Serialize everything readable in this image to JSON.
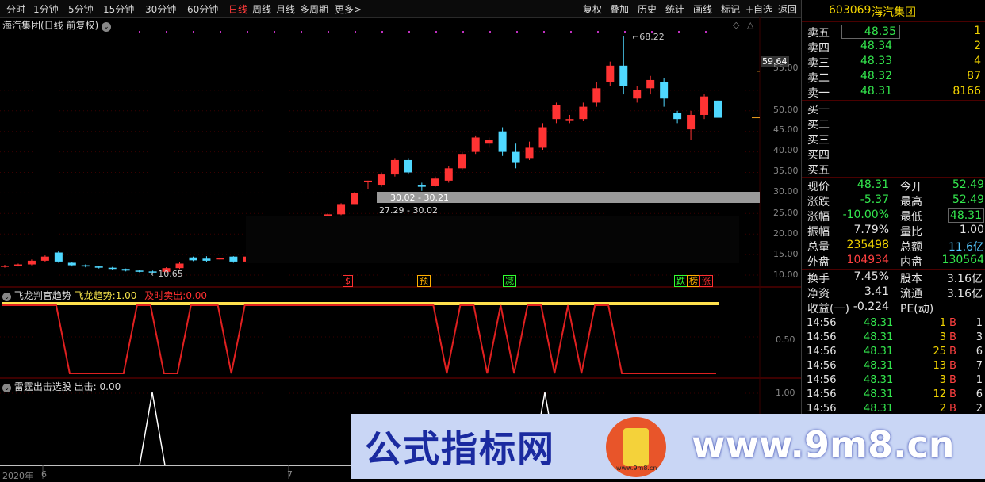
{
  "toolbar": {
    "left": [
      "分时",
      "1分钟",
      "5分钟",
      "15分钟",
      "30分钟",
      "60分钟",
      "日线",
      "周线",
      "月线",
      "多周期",
      "更多"
    ],
    "more_arrow": ">",
    "right": [
      "复权",
      "叠加",
      "历史",
      "统计",
      "画线",
      "标记",
      "+自选",
      "返回"
    ]
  },
  "main_pane": {
    "title": "海汽集团(日线 前复权)",
    "title_icon": "⌄",
    "high_label": "68.22",
    "low_label": "10.65",
    "price_tag": "59.64",
    "range_high": "30.02 - 30.21",
    "range_low": "27.29 - 30.02",
    "y_axis": [
      "55.00",
      "50.00",
      "45.00",
      "40.00",
      "35.00",
      "30.00",
      "25.00",
      "20.00",
      "15.00",
      "10.00"
    ],
    "signals": [
      {
        "text": "$",
        "color": "#ff3030"
      },
      {
        "text": "预",
        "color": "#ffb000"
      },
      {
        "text": "减",
        "color": "#30ff30"
      },
      {
        "text": "跌",
        "color": "#30ff30"
      },
      {
        "text": "榜",
        "color": "#ffb000"
      },
      {
        "text": "涨",
        "color": "#ff3030"
      }
    ],
    "candles": [
      {
        "o": 12.0,
        "c": 12.3,
        "h": 12.5,
        "l": 11.8
      },
      {
        "o": 12.3,
        "c": 12.6,
        "h": 12.8,
        "l": 12.1
      },
      {
        "o": 12.6,
        "c": 13.5,
        "h": 13.8,
        "l": 12.4
      },
      {
        "o": 13.5,
        "c": 14.5,
        "h": 14.8,
        "l": 13.3
      },
      {
        "o": 15.5,
        "c": 13.3,
        "h": 15.8,
        "l": 13.0
      },
      {
        "o": 13.0,
        "c": 12.4,
        "h": 13.2,
        "l": 12.1
      },
      {
        "o": 12.4,
        "c": 12.1,
        "h": 12.6,
        "l": 11.9
      },
      {
        "o": 12.1,
        "c": 11.8,
        "h": 12.3,
        "l": 11.6
      },
      {
        "o": 11.8,
        "c": 11.5,
        "h": 12.0,
        "l": 11.3
      },
      {
        "o": 11.5,
        "c": 11.1,
        "h": 11.6,
        "l": 10.9
      },
      {
        "o": 11.1,
        "c": 10.9,
        "h": 11.3,
        "l": 10.7
      },
      {
        "o": 10.9,
        "c": 10.8,
        "h": 11.1,
        "l": 10.65
      },
      {
        "o": 10.8,
        "c": 11.7,
        "h": 11.9,
        "l": 10.7
      },
      {
        "o": 11.7,
        "c": 12.8,
        "h": 13.2,
        "l": 11.5
      },
      {
        "o": 14.3,
        "c": 13.6,
        "h": 14.5,
        "l": 13.4
      },
      {
        "o": 14.0,
        "c": 13.5,
        "h": 14.6,
        "l": 13.2
      },
      {
        "o": 13.9,
        "c": 14.1,
        "h": 14.3,
        "l": 13.7
      },
      {
        "o": 14.5,
        "c": 13.3,
        "h": 14.6,
        "l": 13.0
      },
      {
        "o": 13.3,
        "c": 14.5,
        "h": 14.7,
        "l": 13.1
      },
      {
        "o": 14.5,
        "c": 15.5,
        "h": 15.8,
        "l": 14.3
      },
      {
        "o": 15.5,
        "c": 17.0,
        "h": 17.2,
        "l": 15.3
      },
      {
        "o": 17.0,
        "c": 18.6,
        "h": 18.8,
        "l": 16.8
      },
      {
        "o": 18.6,
        "c": 20.4,
        "h": 20.6,
        "l": 18.4
      },
      {
        "o": 20.4,
        "c": 22.5,
        "h": 22.7,
        "l": 20.2
      },
      {
        "o": 22.5,
        "c": 24.8,
        "h": 25.0,
        "l": 22.3
      },
      {
        "o": 24.8,
        "c": 27.29,
        "h": 27.5,
        "l": 24.6
      },
      {
        "o": 27.29,
        "c": 30.02,
        "h": 30.21,
        "l": 27.29
      },
      {
        "o": 33.0,
        "c": 33.0,
        "h": 33.0,
        "l": 31.0
      },
      {
        "o": 32.0,
        "c": 34.5,
        "h": 35.0,
        "l": 31.5
      },
      {
        "o": 34.5,
        "c": 38.0,
        "h": 38.5,
        "l": 34.0
      },
      {
        "o": 38.0,
        "c": 35.0,
        "h": 38.5,
        "l": 34.5
      },
      {
        "o": 32.0,
        "c": 31.5,
        "h": 32.5,
        "l": 30.5
      },
      {
        "o": 31.8,
        "c": 33.5,
        "h": 34.0,
        "l": 31.5
      },
      {
        "o": 33.0,
        "c": 36.0,
        "h": 36.5,
        "l": 32.5
      },
      {
        "o": 36.0,
        "c": 39.5,
        "h": 40.0,
        "l": 35.5
      },
      {
        "o": 40.0,
        "c": 43.5,
        "h": 44.0,
        "l": 39.5
      },
      {
        "o": 42.0,
        "c": 43.0,
        "h": 43.5,
        "l": 41.0
      },
      {
        "o": 45.0,
        "c": 40.0,
        "h": 46.0,
        "l": 39.0
      },
      {
        "o": 40.0,
        "c": 37.5,
        "h": 42.0,
        "l": 36.0
      },
      {
        "o": 38.5,
        "c": 41.0,
        "h": 42.5,
        "l": 38.0
      },
      {
        "o": 41.0,
        "c": 46.0,
        "h": 47.0,
        "l": 40.5
      },
      {
        "o": 48.0,
        "c": 51.5,
        "h": 52.0,
        "l": 47.0
      },
      {
        "o": 48.0,
        "c": 48.0,
        "h": 49.0,
        "l": 47.0
      },
      {
        "o": 48.0,
        "c": 51.0,
        "h": 52.0,
        "l": 47.5
      },
      {
        "o": 52.0,
        "c": 55.5,
        "h": 57.0,
        "l": 51.0
      },
      {
        "o": 57.0,
        "c": 61.0,
        "h": 62.0,
        "l": 56.0
      },
      {
        "o": 61.0,
        "c": 56.0,
        "h": 68.22,
        "l": 54.0
      },
      {
        "o": 53.0,
        "c": 55.0,
        "h": 56.0,
        "l": 52.0
      },
      {
        "o": 55.5,
        "c": 57.5,
        "h": 58.5,
        "l": 54.0
      },
      {
        "o": 57.0,
        "c": 53.0,
        "h": 58.0,
        "l": 51.0
      },
      {
        "o": 49.5,
        "c": 48.0,
        "h": 50.0,
        "l": 47.0
      },
      {
        "o": 45.5,
        "c": 49.0,
        "h": 50.0,
        "l": 43.0
      },
      {
        "o": 49.0,
        "c": 53.5,
        "h": 54.0,
        "l": 48.0
      },
      {
        "o": 52.5,
        "c": 48.31,
        "h": 52.5,
        "l": 48.31
      }
    ]
  },
  "feilong_pane": {
    "name": "飞龙判官趋势",
    "label1": "飞龙趋势:",
    "value1": "1.00",
    "label2": "及时卖出:",
    "value2": "0.00",
    "y_axis": [
      "0.50"
    ],
    "series": [
      1,
      1,
      1,
      1,
      1,
      0,
      0,
      0,
      0,
      0,
      1,
      1,
      0,
      0,
      1,
      1,
      1,
      0,
      1,
      1,
      1,
      1,
      1,
      1,
      1,
      1,
      1,
      1,
      1,
      1,
      1,
      1,
      1,
      0,
      1,
      1,
      0,
      1,
      0,
      1,
      1,
      0,
      1,
      0,
      1,
      1,
      0,
      0,
      0,
      0,
      0,
      0,
      0,
      0
    ]
  },
  "leiting_pane": {
    "name": "雷霆出击选股",
    "label": "出击:",
    "value": "0.00",
    "y_axis": [
      "1.00"
    ],
    "spikes": [
      12,
      44
    ],
    "date_year": "2020年",
    "date_marks": [
      "6",
      "7"
    ]
  },
  "quote_panel": {
    "code": "603069",
    "name": "海汽集团",
    "asks": [
      {
        "label": "卖五",
        "price": "48.35",
        "vol": "1"
      },
      {
        "label": "卖四",
        "price": "48.34",
        "vol": "2"
      },
      {
        "label": "卖三",
        "price": "48.33",
        "vol": "4"
      },
      {
        "label": "卖二",
        "price": "48.32",
        "vol": "87"
      },
      {
        "label": "卖一",
        "price": "48.31",
        "vol": "8166"
      }
    ],
    "bids": [
      "买一",
      "买二",
      "买三",
      "买四",
      "买五"
    ],
    "stats": [
      {
        "l1": "现价",
        "v1": "48.31",
        "c1": "green",
        "l2": "今开",
        "v2": "52.49",
        "c2": "green"
      },
      {
        "l1": "涨跌",
        "v1": "-5.37",
        "c1": "green",
        "l2": "最高",
        "v2": "52.49",
        "c2": "green"
      },
      {
        "l1": "涨幅",
        "v1": "-10.00%",
        "c1": "green",
        "l2": "最低",
        "v2": "48.31",
        "c2": "green"
      },
      {
        "l1": "振幅",
        "v1": "7.79%",
        "c1": "white",
        "l2": "量比",
        "v2": "1.00",
        "c2": "white"
      },
      {
        "l1": "总量",
        "v1": "235498",
        "c1": "yel",
        "l2": "总额",
        "v2": "11.6亿",
        "c2": "cyan"
      },
      {
        "l1": "外盘",
        "v1": "104934",
        "c1": "red",
        "l2": "内盘",
        "v2": "130564",
        "c2": "green"
      }
    ],
    "stats2": [
      {
        "l1": "换手",
        "v1": "7.45%",
        "l2": "股本",
        "v2": "3.16亿"
      },
      {
        "l1": "净资",
        "v1": "3.41",
        "l2": "流通",
        "v2": "3.16亿"
      },
      {
        "l1": "收益(一)",
        "v1": "-0.224",
        "l2": "PE(动)",
        "v2": "－"
      }
    ],
    "ticks": [
      {
        "time": "14:56",
        "price": "48.31",
        "vol": "1",
        "side": "B",
        "n": "1"
      },
      {
        "time": "14:56",
        "price": "48.31",
        "vol": "3",
        "side": "B",
        "n": "3"
      },
      {
        "time": "14:56",
        "price": "48.31",
        "vol": "25",
        "side": "B",
        "n": "6"
      },
      {
        "time": "14:56",
        "price": "48.31",
        "vol": "13",
        "side": "B",
        "n": "7"
      },
      {
        "time": "14:56",
        "price": "48.31",
        "vol": "3",
        "side": "B",
        "n": "1"
      },
      {
        "time": "14:56",
        "price": "48.31",
        "vol": "12",
        "side": "B",
        "n": "6"
      },
      {
        "time": "14:56",
        "price": "48.31",
        "vol": "2",
        "side": "B",
        "n": "2"
      }
    ]
  },
  "watermark": {
    "cn_text": "公式指标网",
    "url_text": "www.9m8.cn",
    "logo_text": "www.9m8.cn"
  },
  "colors": {
    "up": "#ff3333",
    "down": "#4fd8ff",
    "trend_line": "#ffe14d",
    "sell_line": "#e02020"
  }
}
